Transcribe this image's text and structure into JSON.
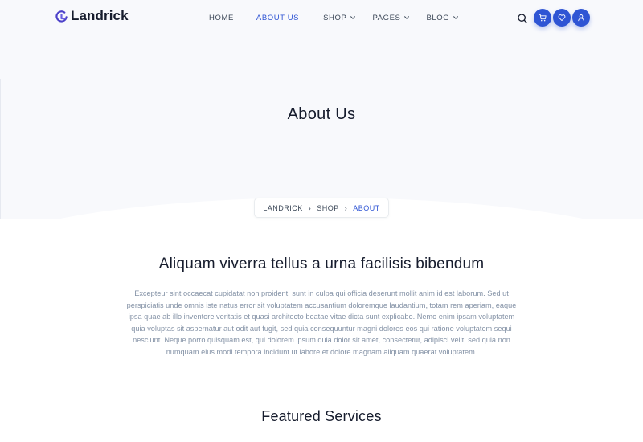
{
  "brand": {
    "name": "Landrick"
  },
  "nav": {
    "items": [
      {
        "label": "HOME",
        "dropdown": false,
        "active": false
      },
      {
        "label": "ABOUT US",
        "dropdown": false,
        "active": true
      },
      {
        "label": "SHOP",
        "dropdown": true,
        "active": false
      },
      {
        "label": "PAGES",
        "dropdown": true,
        "active": false
      },
      {
        "label": "BLOG",
        "dropdown": true,
        "active": false
      }
    ],
    "icons": [
      "search-icon",
      "cart-icon",
      "heart-icon",
      "user-icon"
    ]
  },
  "hero": {
    "title": "About Us"
  },
  "breadcrumb": {
    "items": [
      "LANDRICK",
      "SHOP"
    ],
    "current": "ABOUT"
  },
  "intro": {
    "heading": "Aliquam viverra tellus a urna facilisis bibendum",
    "text": "Excepteur sint occaecat cupidatat non proident, sunt in culpa qui officia deserunt mollit anim id est laborum. Sed ut perspiciatis unde omnis iste natus error sit voluptatem accusantium doloremque laudantium, totam rem aperiam, eaque ipsa quae ab illo inventore veritatis et quasi architecto beatae vitae dicta sunt explicabo. Nemo enim ipsam voluptatem quia voluptas sit aspernatur aut odit aut fugit, sed quia consequuntur magni dolores eos qui ratione voluptatem sequi nesciunt. Neque porro quisquam est, qui dolorem ipsum quia dolor sit amet, consectetur, adipisci velit, sed quia non numquam eius modi tempora incidunt ut labore et dolore magnam aliquam quaerat voluptatem."
  },
  "featured": {
    "heading": "Featured Services"
  },
  "colors": {
    "primary": "#2f55d4",
    "heading": "#161c2d",
    "muted": "#8492a6",
    "hero_bg": "#f8f9fc"
  }
}
